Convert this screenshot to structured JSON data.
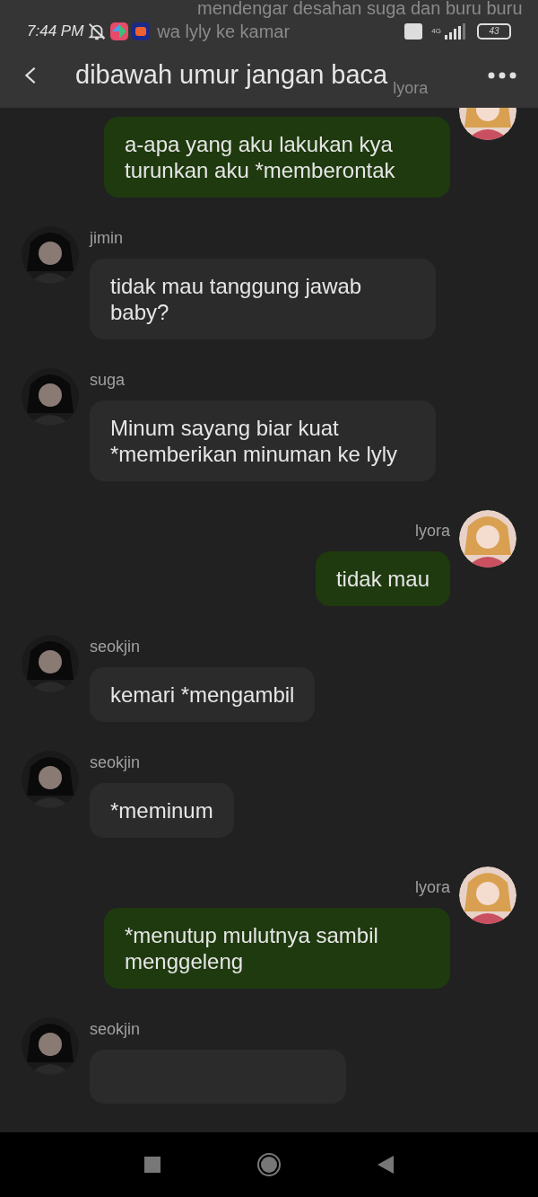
{
  "ghost_text": {
    "line_1": "mendengar desahan suga dan buru buru",
    "line_2": "wa lyly ke kamar",
    "name": "lyora"
  },
  "status_bar": {
    "time": "7:44 PM",
    "battery": "43",
    "network": "4G"
  },
  "header": {
    "title": "dibawah umur jangan baca"
  },
  "messages": [
    {
      "kind": "sent",
      "text": "a-apa yang aku lakukan kya turunkan aku *memberontak"
    },
    {
      "kind": "received",
      "name": "jimin",
      "text": "tidak mau tanggung jawab baby?"
    },
    {
      "kind": "received",
      "name": "suga",
      "text": "Minum sayang biar kuat *memberikan minuman ke lyly"
    },
    {
      "kind": "sent",
      "name": "lyora",
      "text": "tidak mau"
    },
    {
      "kind": "received",
      "name": "seokjin",
      "text": "kemari *mengambil"
    },
    {
      "kind": "received",
      "name": "seokjin",
      "text": "*meminum"
    },
    {
      "kind": "sent",
      "name": "lyora",
      "text": "*menutup mulutnya sambil menggeleng"
    },
    {
      "kind": "received",
      "name": "seokjin"
    }
  ]
}
